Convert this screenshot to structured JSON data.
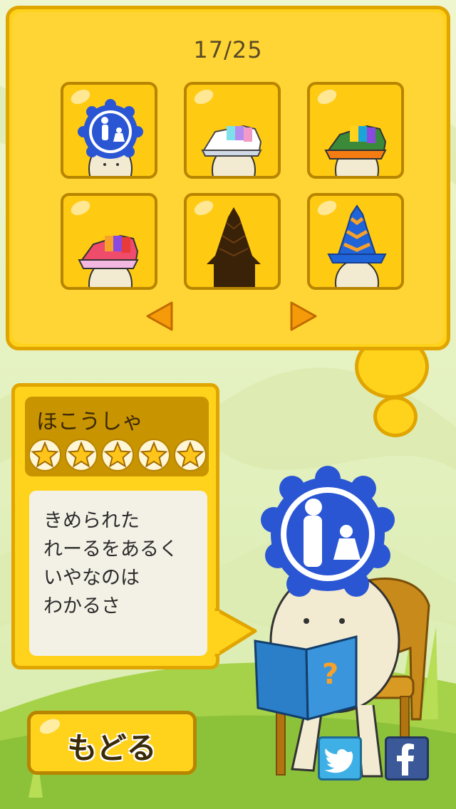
{
  "counter": "17/25",
  "grid": {
    "items": [
      {
        "icon": "pedestrian-sign-icon"
      },
      {
        "icon": "white-sneaker-icon"
      },
      {
        "icon": "orange-sneaker-icon"
      },
      {
        "icon": "pink-sneaker-icon"
      },
      {
        "icon": "silhouette-cone-icon"
      },
      {
        "icon": "blue-cone-icon"
      }
    ],
    "prev_icon": "arrow-left-icon",
    "next_icon": "arrow-right-icon"
  },
  "character": {
    "name": "ほこうしゃ",
    "rating": 5,
    "max_rating": 5,
    "description_lines": [
      "きめられた",
      "れーるをあるく",
      "いやなのは",
      "わかるさ"
    ]
  },
  "back_button": "もどる",
  "social": {
    "twitter_icon": "twitter-icon",
    "facebook_icon": "facebook-icon"
  },
  "colors": {
    "panel": "#ffd21c",
    "border": "#e0a500",
    "accent_orange": "#f59b0a"
  }
}
